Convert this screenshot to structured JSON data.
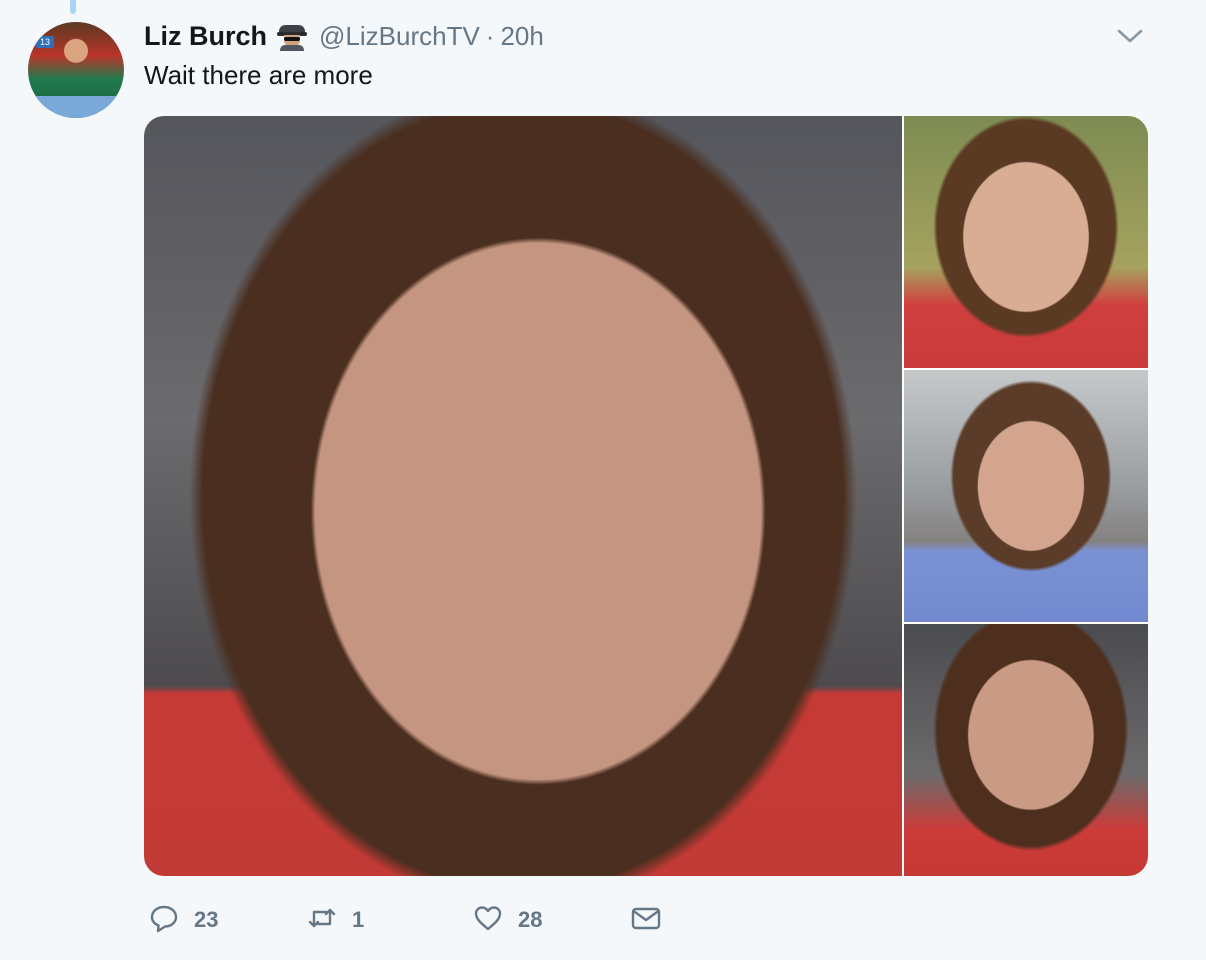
{
  "tweet": {
    "author_name": "Liz Burch",
    "handle": "@LizBurchTV",
    "separator": "·",
    "time": "20h",
    "text": "Wait there are more",
    "avatar_badge": "13",
    "name_emoji": "sleuth-emoji"
  },
  "media": {
    "photo_count": 4
  },
  "actions": {
    "reply_count": "23",
    "retweet_count": "1",
    "like_count": "28"
  },
  "icons": {
    "menu": "chevron-down-icon",
    "reply": "speech-bubble-icon",
    "retweet": "retweet-arrows-icon",
    "like": "heart-icon",
    "dm": "envelope-icon"
  },
  "colors": {
    "background": "#f5f8fa",
    "secondary_text": "#657786",
    "thread_line": "#a8d5f2"
  }
}
